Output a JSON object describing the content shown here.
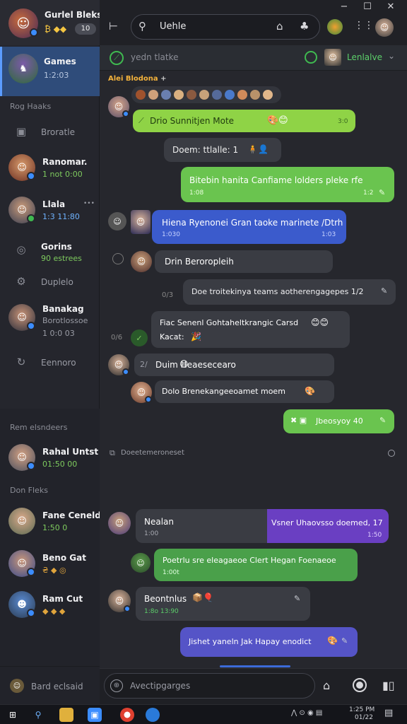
{
  "window": {
    "minimize": "−",
    "maximize": "☐",
    "close": "✕"
  },
  "profile": {
    "name": "Gurlel Bleks",
    "status_pill": "10",
    "coins": "₿ ◆◆"
  },
  "sidebar": {
    "active": {
      "title": "Games",
      "sub": "1:2:03"
    },
    "section_label": "Rog Haaks",
    "plain_item": "Broratle",
    "items": [
      {
        "title": "Ranomar.",
        "sub": "1 not 0:00",
        "sub_color": "#7ecb5e"
      },
      {
        "title": "Llala",
        "sub": "1:3  11:80",
        "sub_color": "#6fb3ff",
        "extra": "•••"
      },
      {
        "title": "Gorins",
        "sub": "90 estrees",
        "sub_color": "#7ecb5e"
      },
      {
        "title": "Duplelo",
        "sub": "",
        "sub_color": "#9a9ca5"
      },
      {
        "title": "Banakag",
        "sub": "Borotlossoe",
        "sub2": "1 0:0 03",
        "sub_color": "#9a9ca5"
      },
      {
        "title": "Eennoro",
        "sub": "",
        "sub_color": "#9a9ca5"
      }
    ],
    "bottom_section_1": "Rem elsndeers",
    "bottom_item_1": {
      "title": "Rahal Untst",
      "sub": "01:50 00",
      "sub_color": "#7ecb5e"
    },
    "bottom_section_2": "Don Fleks",
    "bottom_items": [
      {
        "title": "Fane Cenelde",
        "sub": "1:50 0",
        "sub_color": "#7ecb5e"
      },
      {
        "title": "Beno Gat",
        "sub": "₴ ◆ ◎",
        "sub_color": "#e0a43c"
      },
      {
        "title": "Ram Cut",
        "sub": "◆ ◆ ◆",
        "sub_color": "#e0a43c"
      }
    ],
    "footer": "Bard eclsaid"
  },
  "topbar": {
    "search_value": "Uehle"
  },
  "chat_header": {
    "title": "yedn tlatke",
    "contact": "Lenlalve"
  },
  "messages": {
    "group_label": "Alei Blodona",
    "m1": {
      "text": "Drio Sunnitjen Mote",
      "time": "3:0"
    },
    "m2": {
      "text": "Doem: ttlalle: 1"
    },
    "m3": {
      "text": "Bitebin hanita Canfiame lolders pleke rfe",
      "time": "1:08",
      "time2": "1:2"
    },
    "m4": {
      "text": "Hiena Ryenonei Gran taoke marinete /Dtrh",
      "time": "1:030",
      "time2": "1:03"
    },
    "m5": {
      "text": "Drin Beroropleih"
    },
    "m6": {
      "text": "Doe  troitekinya teams aotherengagepes 1/2",
      "side_time": "0/3"
    },
    "m7": {
      "text": "Fiac Senenl Gohtaheltkrangic Carsd",
      "text2": "Kacat:",
      "side_time": "0/6"
    },
    "m8": {
      "text": "Duim  Heaesecearo",
      "prefix": "2/"
    },
    "m9": {
      "text": "Dolo  Brenekangeeoamet moem"
    },
    "m10": {
      "text": "Jbeosyoy 40"
    },
    "divider_label": "Doeetemeroneset",
    "m11": {
      "text": "Nealan",
      "time": "1:00",
      "right_text": "Vsner Uhaovsso doemed, 17",
      "right_time": "1:50"
    },
    "m12": {
      "text": "Poetrlu sre eleagaeoe Clert Hegan Foenaeoe",
      "time": "1:00t"
    },
    "m13": {
      "text": "Beontnlus",
      "time": "1:8o  13:90"
    },
    "m14": {
      "text": "Jishet yaneln Jak Hapay enodict"
    }
  },
  "input": {
    "placeholder": "Avectipgarges"
  },
  "taskbar": {
    "time": "1:25 PM",
    "date": "01/22"
  }
}
